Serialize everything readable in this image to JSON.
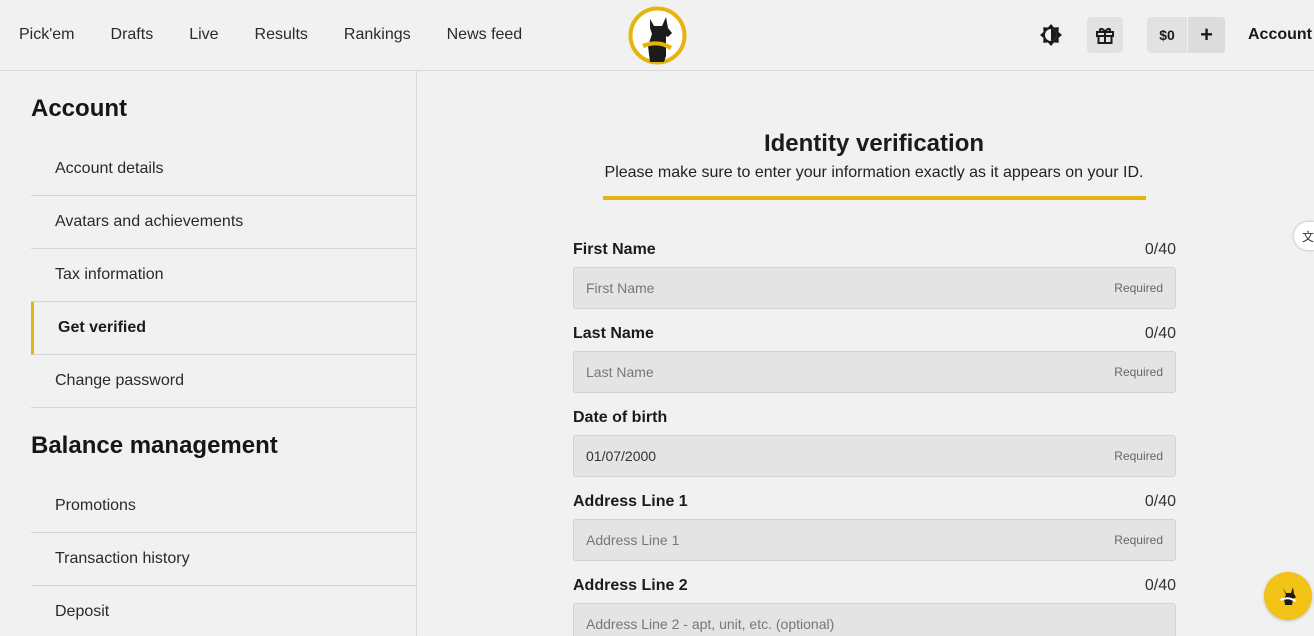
{
  "nav": {
    "items": [
      {
        "label": "Pick'em"
      },
      {
        "label": "Drafts"
      },
      {
        "label": "Live"
      },
      {
        "label": "Results"
      },
      {
        "label": "Rankings"
      },
      {
        "label": "News feed"
      }
    ],
    "balance": "$0",
    "plus": "+",
    "account": "Account"
  },
  "sidebar": {
    "account_title": "Account",
    "account_items": [
      {
        "label": "Account details"
      },
      {
        "label": "Avatars and achievements"
      },
      {
        "label": "Tax information"
      },
      {
        "label": "Get verified",
        "active": true
      },
      {
        "label": "Change password"
      }
    ],
    "balance_title": "Balance management",
    "balance_items": [
      {
        "label": "Promotions"
      },
      {
        "label": "Transaction history"
      },
      {
        "label": "Deposit"
      }
    ]
  },
  "main": {
    "title": "Identity verification",
    "subtitle": "Please make sure to enter your information exactly as it appears on your ID.",
    "fields": [
      {
        "label": "First Name",
        "count": "0/40",
        "placeholder": "First Name",
        "value": "",
        "required": "Required"
      },
      {
        "label": "Last Name",
        "count": "0/40",
        "placeholder": "Last Name",
        "value": "",
        "required": "Required"
      },
      {
        "label": "Date of birth",
        "count": "",
        "placeholder": "01/07/2000",
        "value": "01/07/2000",
        "required": "Required"
      },
      {
        "label": "Address Line 1",
        "count": "0/40",
        "placeholder": "Address Line 1",
        "value": "",
        "required": "Required"
      },
      {
        "label": "Address Line 2",
        "count": "0/40",
        "placeholder": "Address Line 2 - apt, unit, etc. (optional)",
        "value": "",
        "required": ""
      }
    ]
  },
  "translate_glyph": "文",
  "colors": {
    "accent": "#e6b40f",
    "fab": "#f2c217"
  }
}
